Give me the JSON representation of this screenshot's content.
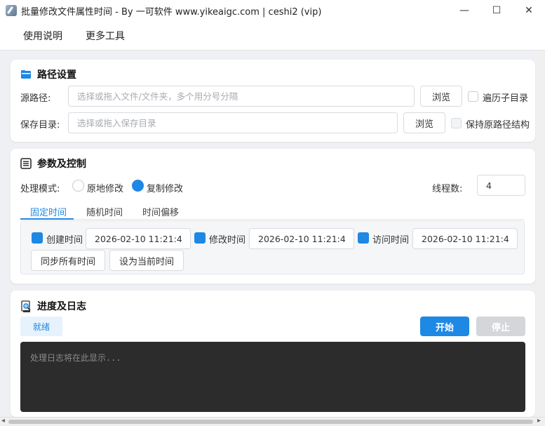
{
  "window": {
    "title": "批量修改文件属性时间 - By 一可软件 www.yikeaigc.com | ceshi2 (vip)",
    "minimize": "—",
    "maximize": "☐",
    "close": "✕"
  },
  "menu": {
    "items": [
      "使用说明",
      "更多工具"
    ]
  },
  "path_settings": {
    "title": "路径设置",
    "source_label": "源路径:",
    "source_placeholder": "选择或拖入文件/文件夹，多个用分号分隔",
    "source_browse": "浏览",
    "recurse_label": "遍历子目录",
    "recurse_checked": false,
    "save_label": "保存目录:",
    "save_placeholder": "选择或拖入保存目录",
    "save_browse": "浏览",
    "keep_structure_label": "保持原路径结构",
    "keep_structure_checked": false
  },
  "params": {
    "title": "参数及控制",
    "mode_label": "处理模式:",
    "mode_options": [
      "原地修改",
      "复制修改"
    ],
    "mode_selected": "复制修改",
    "threads_label": "线程数:",
    "threads_value": "4",
    "tabs": [
      "固定时间",
      "随机时间",
      "时间偏移"
    ],
    "active_tab": "固定时间",
    "fixed": {
      "created_label": "创建时间",
      "created_value": "2026-02-10 11:21:4",
      "modified_label": "修改时间",
      "modified_value": "2026-02-10 11:21:4",
      "accessed_label": "访问时间",
      "accessed_value": "2026-02-10 11:21:4",
      "sync_button": "同步所有时间",
      "now_button": "设为当前时间"
    }
  },
  "progress": {
    "title": "进度及日志",
    "status": "就绪",
    "start_button": "开始",
    "stop_button": "停止",
    "log_placeholder": "处理日志将在此显示..."
  },
  "colors": {
    "accent": "#1e88e5",
    "log_bg": "#2c2c2c"
  }
}
